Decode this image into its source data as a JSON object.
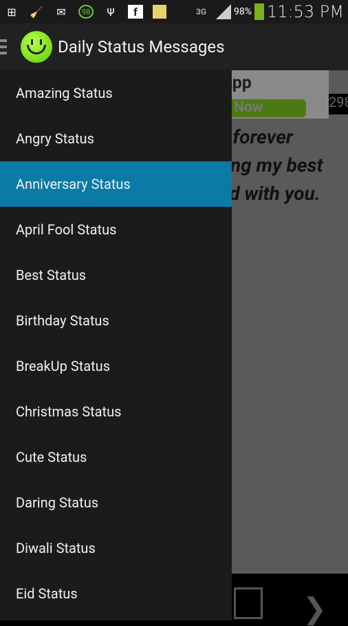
{
  "status_bar": {
    "icons": [
      "add-icon",
      "cleaner-icon",
      "mail-icon",
      "battery-98-badge-icon",
      "usb-icon",
      "facebook-icon",
      "notes-icon"
    ],
    "badge": "98",
    "network": "3G",
    "battery": "98%",
    "time": "11:53 PM"
  },
  "action_bar": {
    "title": "Daily Status Messages"
  },
  "background": {
    "ad_line1": "sifieds App",
    "ad_line2": "oad Now",
    "ad_number": "298",
    "message_lines": [
      "g forever",
      "ving my best",
      "ld with you."
    ]
  },
  "drawer": {
    "items": [
      {
        "label": "Amazing Status"
      },
      {
        "label": "Angry Status"
      },
      {
        "label": "Anniversary Status",
        "selected": true
      },
      {
        "label": "April Fool Status"
      },
      {
        "label": "Best Status"
      },
      {
        "label": "Birthday Status"
      },
      {
        "label": "BreakUp Status"
      },
      {
        "label": "Christmas Status"
      },
      {
        "label": "Cute Status"
      },
      {
        "label": "Daring Status"
      },
      {
        "label": "Diwali Status"
      },
      {
        "label": "Eid Status"
      }
    ]
  },
  "colors": {
    "selected": "#0a7ba6",
    "drawer": "#1b1b1b",
    "actionbar": "#212121"
  }
}
